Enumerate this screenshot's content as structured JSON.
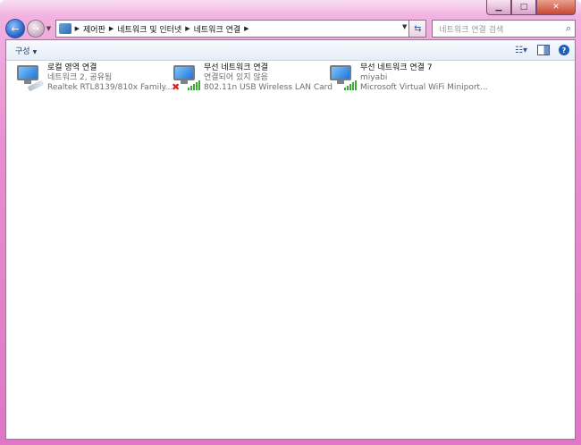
{
  "address_bar": {
    "breadcrumbs": [
      "제어판",
      "네트워크 및 인터넷",
      "네트워크 연결"
    ]
  },
  "search": {
    "placeholder": "네트워크 연결 검색"
  },
  "toolbar": {
    "organize_label": "구성"
  },
  "connections": [
    {
      "name": "로컬 영역 연결",
      "status": "네트워크 2, 공유됨",
      "device": "Realtek RTL8139/810x Family...",
      "icon": "wired-network-icon"
    },
    {
      "name": "무선 네트워크 연결",
      "status": "연결되어 있지 않음",
      "device": "802.11n USB Wireless LAN Card",
      "icon": "wireless-disconnected-icon"
    },
    {
      "name": "무선 네트워크 연결 7",
      "status": "miyabi",
      "device": "Microsoft Virtual WiFi Miniport...",
      "icon": "wireless-network-icon"
    }
  ],
  "colors": {
    "window_frame": "#e98cd0",
    "signal_green": "#43a63a",
    "error_red": "#d8261c"
  }
}
